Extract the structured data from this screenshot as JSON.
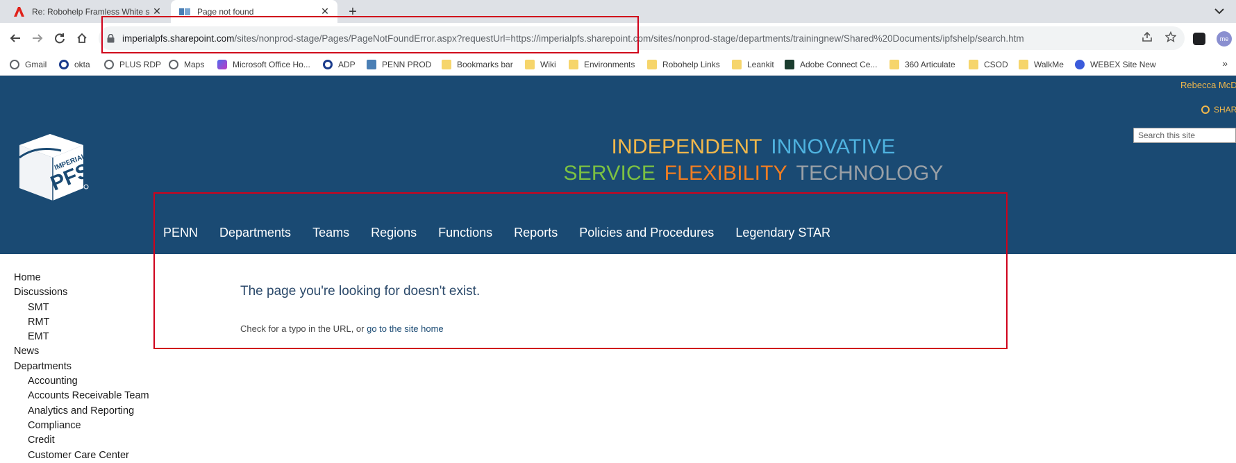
{
  "browser": {
    "tabs": [
      {
        "title": "Re: Robohelp Framless White sea",
        "icon": "adobe-icon",
        "active": false
      },
      {
        "title": "Page not found",
        "icon": "pfs-favicon",
        "active": true
      }
    ],
    "url": {
      "host": "imperialpfs.sharepoint.com",
      "path": "/sites/nonprod-stage/Pages/PageNotFoundError.aspx?requestUrl=https://imperialpfs.sharepoint.com/sites/nonprod-stage/departments/trainingnew/Shared%20Documents/ipfshelp/search.htm"
    },
    "bookmarks": [
      {
        "label": "Gmail",
        "icon": "globe"
      },
      {
        "label": "okta",
        "icon": "okta"
      },
      {
        "label": "PLUS RDP",
        "icon": "globe"
      },
      {
        "label": "Maps",
        "icon": "globe"
      },
      {
        "label": "Microsoft Office Ho...",
        "icon": "ms"
      },
      {
        "label": "ADP",
        "icon": "okta"
      },
      {
        "label": "PENN PROD",
        "icon": "pfs"
      },
      {
        "label": "Bookmarks bar",
        "icon": "folder"
      },
      {
        "label": "Wiki",
        "icon": "folder"
      },
      {
        "label": "Environments",
        "icon": "folder"
      },
      {
        "label": "Robohelp Links",
        "icon": "folder"
      },
      {
        "label": "Leankit",
        "icon": "folder"
      },
      {
        "label": "Adobe Connect Ce...",
        "icon": "lk"
      },
      {
        "label": "360 Articulate",
        "icon": "folder"
      },
      {
        "label": "CSOD",
        "icon": "folder"
      },
      {
        "label": "WalkMe",
        "icon": "folder"
      },
      {
        "label": "WEBEX Site New",
        "icon": "webex"
      }
    ]
  },
  "site": {
    "user": "Rebecca McD",
    "share_label": "SHARE",
    "search_placeholder": "Search this site",
    "tagline": {
      "line1": [
        {
          "text": "INDEPENDENT",
          "color": "#f2b84b"
        },
        {
          "text": "INNOVATIVE",
          "color": "#4fb3e0"
        }
      ],
      "line2": [
        {
          "text": "SERVICE",
          "color": "#7cc142"
        },
        {
          "text": "FLEXIBILITY",
          "color": "#f07d22"
        },
        {
          "text": "TECHNOLOGY",
          "color": "#9aa0a6"
        }
      ]
    },
    "nav": [
      "PENN",
      "Departments",
      "Teams",
      "Regions",
      "Functions",
      "Reports",
      "Policies and Procedures",
      "Legendary STAR"
    ],
    "sidenav": [
      {
        "label": "Home",
        "sub": false
      },
      {
        "label": "Discussions",
        "sub": false
      },
      {
        "label": "SMT",
        "sub": true
      },
      {
        "label": "RMT",
        "sub": true
      },
      {
        "label": "EMT",
        "sub": true
      },
      {
        "label": "News",
        "sub": false
      },
      {
        "label": "Departments",
        "sub": false
      },
      {
        "label": "Accounting",
        "sub": true
      },
      {
        "label": "Accounts Receivable Team",
        "sub": true
      },
      {
        "label": "Analytics and Reporting",
        "sub": true
      },
      {
        "label": "Compliance",
        "sub": true
      },
      {
        "label": "Credit",
        "sub": true
      },
      {
        "label": "Customer Care Center",
        "sub": true
      }
    ]
  },
  "error": {
    "title": "The page you're looking for doesn't exist.",
    "body_prefix": "Check for a typo in the URL, or ",
    "home_link": "go to the site home"
  },
  "colors": {
    "banner": "#1a4a73",
    "annotation": "#d0021b"
  }
}
